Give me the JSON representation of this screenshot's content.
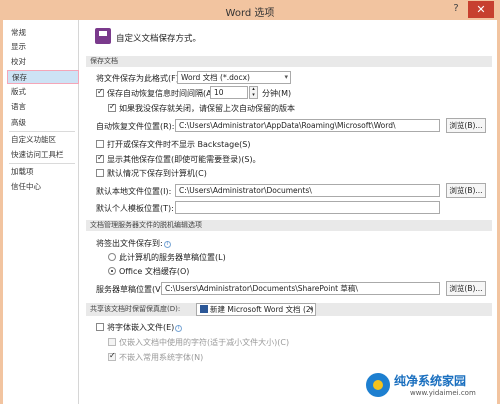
{
  "window": {
    "title": "Word 选项",
    "help_glyph": "?",
    "close_glyph": "✕"
  },
  "sidebar": {
    "items": [
      {
        "label": "常规"
      },
      {
        "label": "显示"
      },
      {
        "label": "校对"
      },
      {
        "label": "保存",
        "active": true
      },
      {
        "label": "版式"
      },
      {
        "label": "语言"
      },
      {
        "label": "高级"
      },
      {
        "label": "自定义功能区"
      },
      {
        "label": "快速访问工具栏"
      },
      {
        "label": "加载项"
      },
      {
        "label": "信任中心"
      }
    ]
  },
  "header": {
    "text": "自定义文档保存方式。"
  },
  "save_docs": {
    "section_title": "保存文档",
    "format_label": "将文件保存为此格式(F):",
    "format_value": "Word 文档 (*.docx)",
    "autorecover_label": "保存自动恢复信息时间间隔(A)",
    "autorecover_checked": true,
    "minutes_value": "10",
    "minutes_unit": "分钟(M)",
    "keep_last_label": "如果我没保存就关闭，请保留上次自动保留的版本",
    "keep_last_checked": true,
    "autorecover_loc_label": "自动恢复文件位置(R):",
    "autorecover_loc_value": "C:\\Users\\Administrator\\AppData\\Roaming\\Microsoft\\Word\\",
    "browse_label": "浏览(B)...",
    "no_backstage_label": "打开或保存文件时不显示 Backstage(S)",
    "no_backstage_checked": false,
    "show_other_label": "显示其他保存位置(即使可能需要登录)(S)。",
    "show_other_checked": true,
    "default_computer_label": "默认情况下保存到计算机(C)",
    "default_computer_checked": false,
    "default_local_label": "默认本地文件位置(I):",
    "default_local_value": "C:\\Users\\Administrator\\Documents\\",
    "browse2_label": "浏览(B)...",
    "personal_template_label": "默认个人模板位置(T):",
    "personal_template_value": ""
  },
  "offline": {
    "section_title": "文档管理服务器文件的脱机编辑选项",
    "saveto_label": "将签出文件保存到:",
    "opt_server": "此计算机的服务器草稿位置(L)",
    "opt_cache": "Office 文档缓存(O)",
    "drafts_label": "服务器草稿位置(V):",
    "drafts_value": "C:\\Users\\Administrator\\Documents\\SharePoint 草稿\\",
    "browse3_label": "浏览(B)..."
  },
  "fidelity": {
    "section_title": "共享该文档时保留保真度(D):",
    "doc_value": "新建 Microsoft Word 文档 (2)",
    "embed_label": "将字体嵌入文件(E)",
    "embed_checked": false,
    "only_used_label": "仅嵌入文档中使用的字符(适于减小文件大小)(C)",
    "no_common_label": "不嵌入常用系统字体(N)"
  },
  "watermark": {
    "text": "纯净系统家园",
    "url": "www.yidaimei.com"
  }
}
